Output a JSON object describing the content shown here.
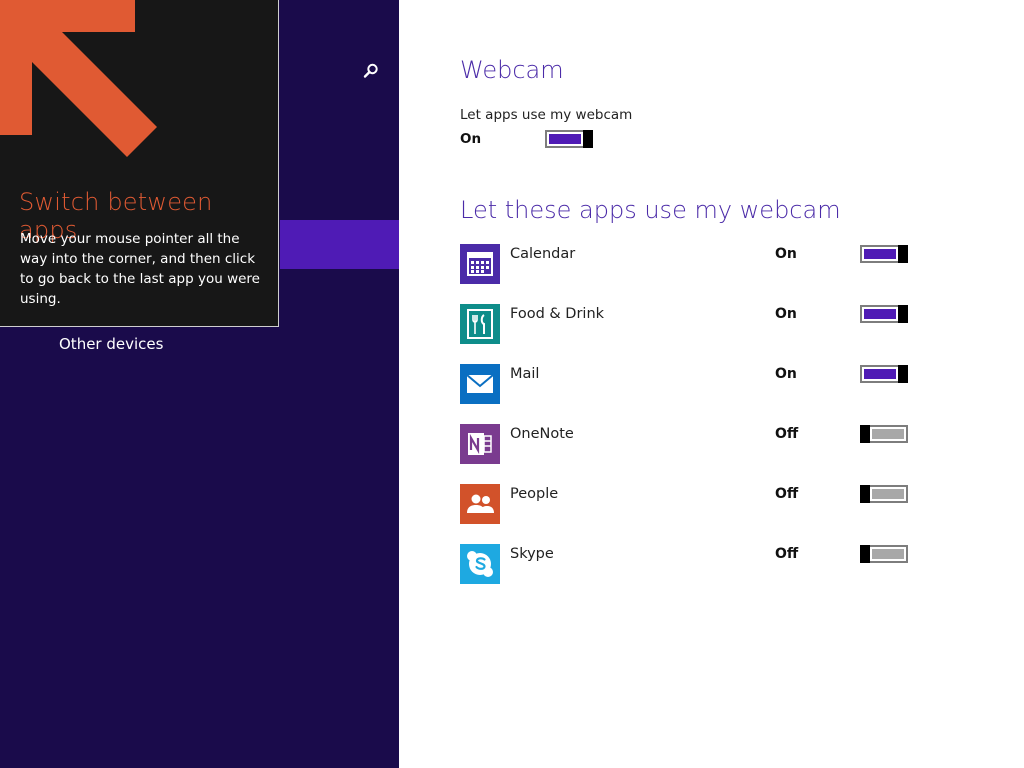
{
  "nav": {
    "other_devices": "Other devices"
  },
  "tip": {
    "title": "Switch between apps",
    "body": "Move your mouse pointer all the way into the corner, and then click to go back to the last app you were using."
  },
  "main": {
    "section_title": "Webcam",
    "master": {
      "label": "Let apps use my webcam",
      "state": "On",
      "on": true
    },
    "apps_title": "Let these apps use my webcam",
    "apps": [
      {
        "name": "Calendar",
        "state": "On",
        "on": true,
        "icon": "calendar-icon",
        "color": "#4b2ba8"
      },
      {
        "name": "Food & Drink",
        "state": "On",
        "on": true,
        "icon": "food-drink-icon",
        "color": "#0e8d8a"
      },
      {
        "name": "Mail",
        "state": "On",
        "on": true,
        "icon": "mail-icon",
        "color": "#0a6fc2"
      },
      {
        "name": "OneNote",
        "state": "Off",
        "on": false,
        "icon": "onenote-icon",
        "color": "#7a3b8f"
      },
      {
        "name": "People",
        "state": "Off",
        "on": false,
        "icon": "people-icon",
        "color": "#d2522a"
      },
      {
        "name": "Skype",
        "state": "Off",
        "on": false,
        "icon": "skype-icon",
        "color": "#1ea9e1"
      }
    ]
  },
  "colors": {
    "nav_bg": "#1a0b4b",
    "accent": "#4f1bb5",
    "heading": "#4b2ba8",
    "tip_title": "#e05a33"
  }
}
